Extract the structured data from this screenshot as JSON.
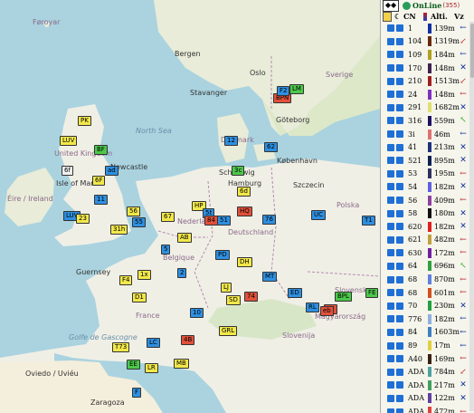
{
  "map": {
    "labels": {
      "faroyar": "Føroyar",
      "sverige": "Sverige",
      "bergen": "Bergen",
      "oslo": "Oslo",
      "stavanger": "Stavanger",
      "goteborg": "Göteborg",
      "kobenhavn": "København",
      "danmark": "Danmark",
      "north_sea": "North Sea",
      "uk": "United Kingdom",
      "newcastle": "Newcastle",
      "isle_of_man": "Isle of Man",
      "eire": "Éire / Ireland",
      "hamburg": "Hamburg",
      "schleswig": "Schleswig",
      "szczecin": "Szczecin",
      "polska": "Polska",
      "deutschland": "Deutschland",
      "nederland": "Nederland",
      "belgique": "Belgique",
      "guernsey": "Guernsey",
      "france": "France",
      "slovensko": "Slovensko",
      "magyarorszag": "Magyarország",
      "slovenija": "Slovenija",
      "golfe": "Golfe de Gascogne",
      "oviedo": "Oviedo / Uviéu",
      "zaragoza": "Zaragoza",
      "esv": "EE"
    },
    "markers": [
      {
        "t": "PK",
        "c": "y"
      },
      {
        "t": "LUV",
        "c": "y"
      },
      {
        "t": "BF",
        "c": "g"
      },
      {
        "t": "6f",
        "c": "w"
      },
      {
        "t": "ad",
        "c": "b"
      },
      {
        "t": "12",
        "c": "b"
      },
      {
        "t": "6F",
        "c": "y"
      },
      {
        "t": "11",
        "c": "b"
      },
      {
        "t": "3c",
        "c": "g"
      },
      {
        "t": "6d",
        "c": "y"
      },
      {
        "t": "HP",
        "c": "y"
      },
      {
        "t": "5t",
        "c": "b"
      },
      {
        "t": "51",
        "c": "b"
      },
      {
        "t": "HQ",
        "c": "r"
      },
      {
        "t": "76",
        "c": "b"
      },
      {
        "t": "LUV",
        "c": "b"
      },
      {
        "t": "31h",
        "c": "y"
      },
      {
        "t": "23",
        "c": "y"
      },
      {
        "t": "56",
        "c": "y"
      },
      {
        "t": "55",
        "c": "b"
      },
      {
        "t": "T1",
        "c": "b"
      },
      {
        "t": "67",
        "c": "y"
      },
      {
        "t": "BPN",
        "c": "r"
      },
      {
        "t": "LM",
        "c": "g"
      },
      {
        "t": "F2",
        "c": "b"
      },
      {
        "t": "62",
        "c": "b"
      },
      {
        "t": "AB",
        "c": "y"
      },
      {
        "t": "UC",
        "c": "b"
      },
      {
        "t": "84",
        "c": "r"
      },
      {
        "t": "PD",
        "c": "b"
      },
      {
        "t": "DH",
        "c": "y"
      },
      {
        "t": "LJ",
        "c": "y"
      },
      {
        "t": "SD",
        "c": "y"
      },
      {
        "t": "74",
        "c": "r"
      },
      {
        "t": "MT",
        "c": "b"
      },
      {
        "t": "ED",
        "c": "b"
      },
      {
        "t": "BPL",
        "c": "g"
      },
      {
        "t": "FE",
        "c": "g"
      },
      {
        "t": "RL",
        "c": "b"
      },
      {
        "t": "62",
        "c": "r"
      },
      {
        "t": "4B",
        "c": "r"
      },
      {
        "t": "GRL",
        "c": "y"
      },
      {
        "t": "T73",
        "c": "y"
      },
      {
        "t": "EE",
        "c": "g"
      },
      {
        "t": "LR",
        "c": "y"
      },
      {
        "t": "MB",
        "c": "y"
      },
      {
        "t": "F",
        "c": "b"
      },
      {
        "t": "LC",
        "c": "b"
      },
      {
        "t": "5",
        "c": "b"
      },
      {
        "t": "2",
        "c": "b"
      },
      {
        "t": "F4",
        "c": "y"
      },
      {
        "t": "D1",
        "c": "y"
      },
      {
        "t": "1x",
        "c": "y"
      },
      {
        "t": "10",
        "c": "b"
      },
      {
        "t": "eb",
        "c": "r"
      }
    ]
  },
  "panel": {
    "top": {
      "switch": "◆◆",
      "online": "OnLine",
      "count": "(355)"
    },
    "header": {
      "cn": "CN",
      "alt": "Alti.",
      "vz": "Vz"
    },
    "rows": [
      {
        "cn": "1",
        "alt": "139m",
        "arrow": "←",
        "color": "#1030a0",
        "acol": "#1030a0"
      },
      {
        "cn": "104",
        "alt": "1319m",
        "arrow": "↙",
        "color": "#6a2a0a",
        "acol": "#c02020"
      },
      {
        "cn": "109",
        "alt": "184m",
        "arrow": "←",
        "color": "#b0a020",
        "acol": "#1030a0"
      },
      {
        "cn": "170",
        "alt": "148m",
        "arrow": "✕",
        "color": "#402050",
        "acol": "#1030a0"
      },
      {
        "cn": "210",
        "alt": "1513m",
        "arrow": "↙",
        "color": "#a02020",
        "acol": "#c02020"
      },
      {
        "cn": "24",
        "alt": "148m",
        "arrow": "←",
        "color": "#8030c0",
        "acol": "#c02020"
      },
      {
        "cn": "291",
        "alt": "1682m",
        "arrow": "✕",
        "color": "#e0e070",
        "acol": "#1030a0"
      },
      {
        "cn": "316",
        "alt": "559m",
        "arrow": "↖",
        "color": "#201060",
        "acol": "#20a020"
      },
      {
        "cn": "3i",
        "alt": "46m",
        "arrow": "←",
        "color": "#e07070",
        "acol": "#1030a0"
      },
      {
        "cn": "41",
        "alt": "213m",
        "arrow": "✕",
        "color": "#203080",
        "acol": "#1030a0"
      },
      {
        "cn": "521",
        "alt": "895m",
        "arrow": "✕",
        "color": "#102050",
        "acol": "#1030a0"
      },
      {
        "cn": "53",
        "alt": "195m",
        "arrow": "←",
        "color": "#303060",
        "acol": "#c02020"
      },
      {
        "cn": "54",
        "alt": "182m",
        "arrow": "✕",
        "color": "#6060e0",
        "acol": "#1030a0"
      },
      {
        "cn": "56",
        "alt": "409m",
        "arrow": "←",
        "color": "#9040a0",
        "acol": "#c02020"
      },
      {
        "cn": "58",
        "alt": "180m",
        "arrow": "✕",
        "color": "#101010",
        "acol": "#1030a0"
      },
      {
        "cn": "620",
        "alt": "182m",
        "arrow": "✕",
        "color": "#e02020",
        "acol": "#1030a0"
      },
      {
        "cn": "621",
        "alt": "482m",
        "arrow": "←",
        "color": "#c0a040",
        "acol": "#c02020"
      },
      {
        "cn": "630",
        "alt": "172m",
        "arrow": "←",
        "color": "#7020a0",
        "acol": "#c02020"
      },
      {
        "cn": "64",
        "alt": "696m",
        "arrow": "↖",
        "color": "#30a040",
        "acol": "#20a020"
      },
      {
        "cn": "68",
        "alt": "870m",
        "arrow": "←",
        "color": "#6080e0",
        "acol": "#c02020"
      },
      {
        "cn": "68",
        "alt": "601m",
        "arrow": "←",
        "color": "#d05020",
        "acol": "#c02020"
      },
      {
        "cn": "70",
        "alt": "230m",
        "arrow": "✕",
        "color": "#20a040",
        "acol": "#1030a0"
      },
      {
        "cn": "776",
        "alt": "182m",
        "arrow": "←",
        "color": "#90b0e0",
        "acol": "#1030a0"
      },
      {
        "cn": "84",
        "alt": "1603m",
        "arrow": "←",
        "color": "#4080c0",
        "acol": "#1030a0"
      },
      {
        "cn": "89",
        "alt": "17m",
        "arrow": "←",
        "color": "#e0d040",
        "acol": "#1030a0"
      },
      {
        "cn": "A40",
        "alt": "169m",
        "arrow": "←",
        "color": "#3a2010",
        "acol": "#c02020"
      },
      {
        "cn": "ADA",
        "alt": "784m",
        "arrow": "↙",
        "color": "#50a0a0",
        "acol": "#c02020"
      },
      {
        "cn": "ADA",
        "alt": "217m",
        "arrow": "✕",
        "color": "#40a060",
        "acol": "#1030a0"
      },
      {
        "cn": "ADA",
        "alt": "122m",
        "arrow": "✕",
        "color": "#6040a0",
        "acol": "#1030a0"
      },
      {
        "cn": "ADA",
        "alt": "472m",
        "arrow": "←",
        "color": "#e04040",
        "acol": "#c02020"
      },
      {
        "cn": "ADA",
        "alt": "372m",
        "arrow": "✕",
        "color": "#e0a040",
        "acol": "#1030a0"
      }
    ]
  }
}
